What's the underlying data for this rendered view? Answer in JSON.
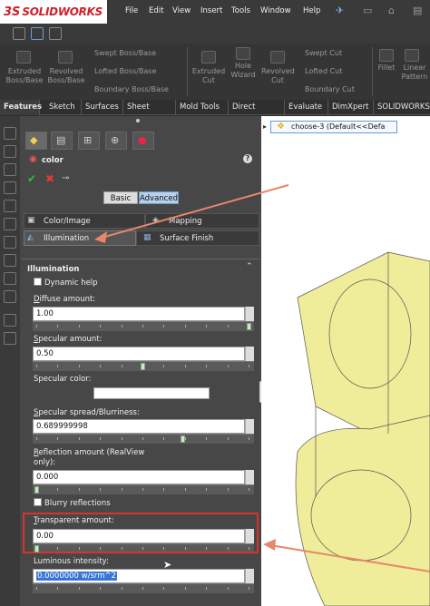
{
  "app": {
    "logo_prefix": "3S",
    "logo_name": "SOLIDWORKS"
  },
  "menu": [
    "File",
    "Edit",
    "View",
    "Insert",
    "Tools",
    "Window",
    "Help"
  ],
  "ribbon": {
    "extruded_boss": "Extruded Boss/Base",
    "revolved_boss": "Revolved Boss/Base",
    "swept_boss": "Swept Boss/Base",
    "lofted_boss": "Lofted Boss/Base",
    "boundary_boss": "Boundary Boss/Base",
    "extruded_cut": "Extruded Cut",
    "hole_wizard": "Hole Wizard",
    "revolved_cut": "Revolved Cut",
    "swept_cut": "Swept Cut",
    "lofted_cut": "Lofted Cut",
    "boundary_cut": "Boundary Cut",
    "fillet": "Fillet",
    "linear_pattern": "Linear Pattern"
  },
  "tabs": [
    "Features",
    "Sketch",
    "Surfaces",
    "Sheet Metal",
    "Mold Tools",
    "Direct Editing",
    "Evaluate",
    "DimXpert",
    "SOLIDWORKS"
  ],
  "tree": {
    "item": "choose-3  (Default<<Defa"
  },
  "panel": {
    "title": "color",
    "help": "?",
    "basic": "Basic",
    "advanced": "Advanced",
    "color_image": "Color/Image",
    "mapping": "Mapping",
    "illumination_tab": "Illumination",
    "surface_finish": "Surface Finish",
    "section": "Illumination",
    "dynamic_help": "Dynamic help",
    "diffuse_label_u": "D",
    "diffuse_label": "iffuse amount:",
    "diffuse_value": "1.00",
    "specular_label_u": "S",
    "specular_label": "pecular amount:",
    "specular_value": "0.50",
    "specular_color": "Specular color:",
    "spread_label_u": "S",
    "spread_label": "pecular spread/Blurriness:",
    "spread_value": "0.689999998",
    "reflection_label_u": "R",
    "reflection_label": "eflection amount (RealView only):",
    "reflection_value": "0.000",
    "blurry": "Blurry reflections",
    "transparent_label_u": "T",
    "transparent_label": "ransparent amount:",
    "transparent_value": "0.00",
    "luminous_label": "Luminous intensity:",
    "luminous_value": "0.0000000 w/srm^2"
  },
  "sliders": {
    "diffuse": 1.0,
    "specular": 0.5,
    "spread": 0.69,
    "reflection": 0.0,
    "transparent": 0.0
  },
  "colors": {
    "highlight_box": "#d9342b",
    "arrow": "#e8876a",
    "model_fill": "#efec9a"
  }
}
